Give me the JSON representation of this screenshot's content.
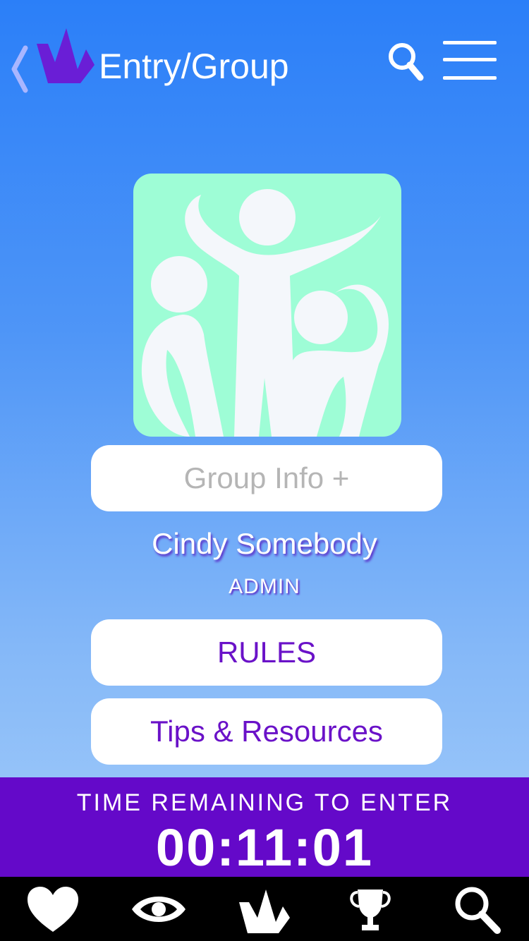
{
  "header": {
    "title": "Entry/Group",
    "back_icon": "chevron-left-icon",
    "logo_icon": "crown-logo",
    "search_icon": "search-icon",
    "menu_icon": "hamburger-menu-icon"
  },
  "group": {
    "image_icon": "group-people-icon",
    "info_button_label": "Group Info +"
  },
  "admin": {
    "name": "Cindy Somebody",
    "role": "ADMIN"
  },
  "actions": {
    "rules_label": "RULES",
    "tips_label": "Tips & Resources"
  },
  "timer": {
    "label": "TIME REMAINING TO ENTER",
    "value": "00:11:01"
  },
  "tabbar": {
    "items": [
      {
        "icon": "heart-icon"
      },
      {
        "icon": "eye-icon"
      },
      {
        "icon": "crown-logo-icon"
      },
      {
        "icon": "trophy-icon"
      },
      {
        "icon": "search-icon"
      }
    ]
  },
  "colors": {
    "accent_purple": "#6a12c8",
    "timer_bar": "#6409c9",
    "group_tile": "#9efdd6",
    "logo_purple": "#6a1ed6"
  }
}
